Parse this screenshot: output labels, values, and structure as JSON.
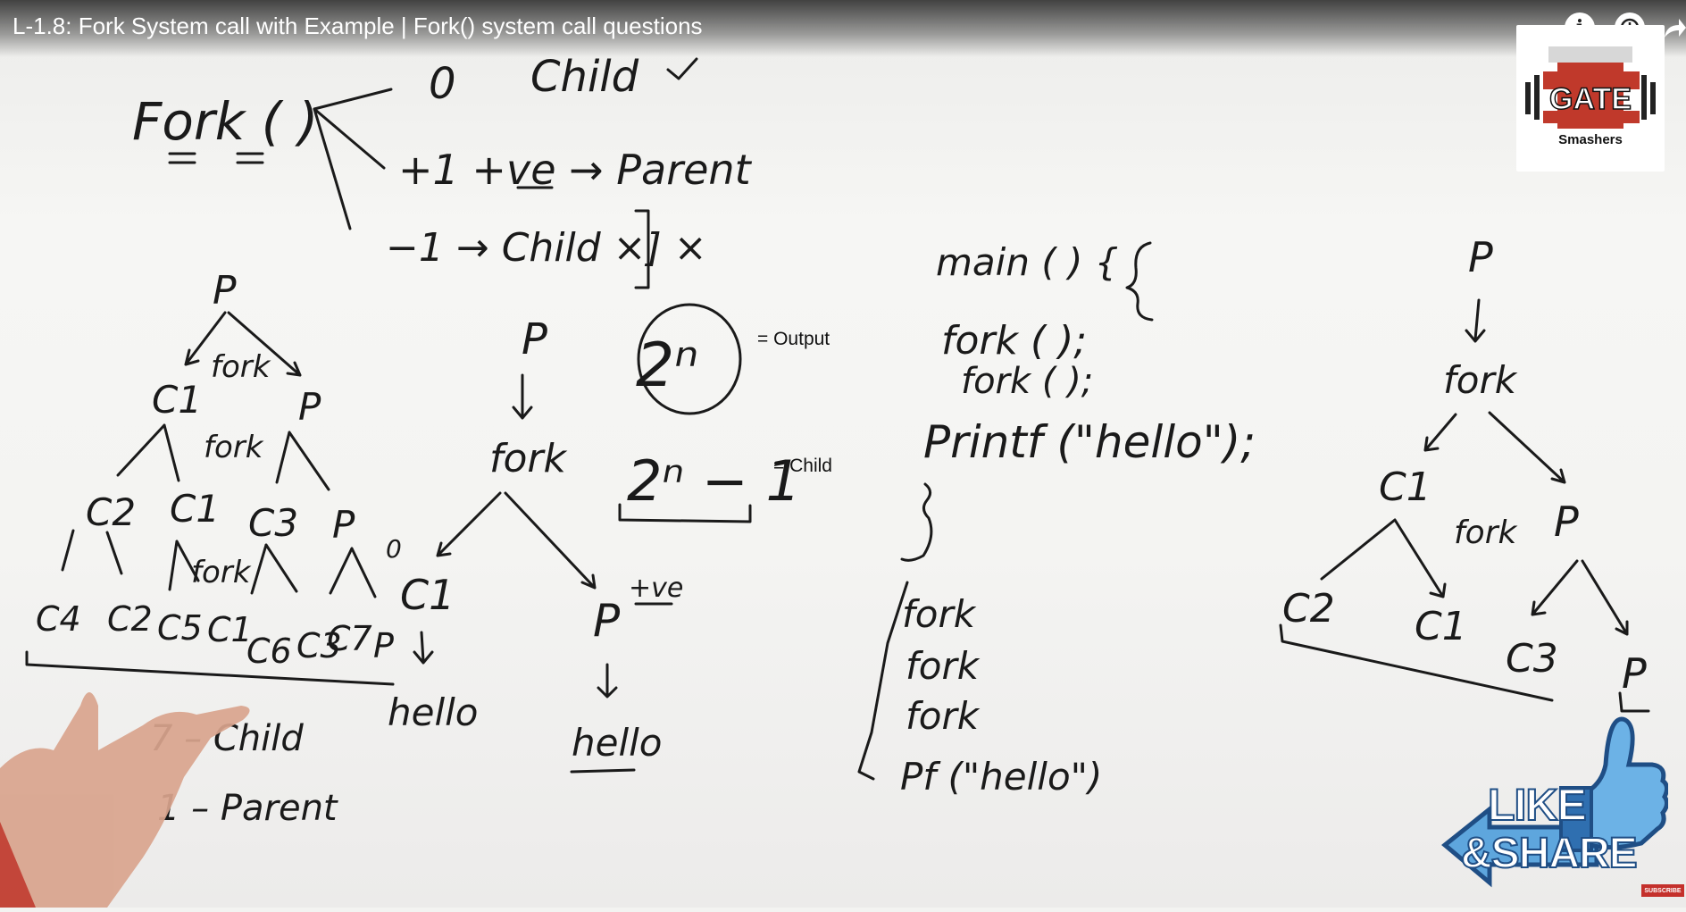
{
  "video": {
    "title": "L-1.8: Fork System call with Example | Fork() system call questions"
  },
  "controls": {
    "info_icon": "info-icon",
    "watch_later_icon": "clock-icon",
    "share_icon": "share-icon",
    "info_glyph": "i"
  },
  "logo": {
    "name": "GATE",
    "sub": "Smashers"
  },
  "annotations": {
    "output_label": "= Output",
    "child_label": "= Child"
  },
  "overlay": {
    "like": "LIKE",
    "share": "&SHARE",
    "subscribe": "SUBSCRIBE"
  },
  "whiteboard": {
    "fork_returns": {
      "title": "Fork ( )",
      "zero": "0",
      "zero_meaning": "Child",
      "positive": "+1  +ve → Parent",
      "negative": "−1 → Child ×] ×"
    },
    "formula_output": "2ⁿ",
    "formula_child": "2ⁿ − 1",
    "code": {
      "main": "main ( ) {",
      "line1": "fork ( );",
      "line2": "fork ( );",
      "line3": "Printf (\"hello\");",
      "close": "}"
    },
    "expanded": [
      "fork",
      "fork",
      "fork",
      "Pf (\"hello\")"
    ],
    "tree_left": {
      "root": "P",
      "fork1": "fork",
      "level1": [
        "C1",
        "P"
      ],
      "fork2": "fork",
      "level2": [
        "C2",
        "C1",
        "C3",
        "P"
      ],
      "fork3": "fork",
      "level3": [
        "C4",
        "C2",
        "C5",
        "C1",
        "C6",
        "C3",
        "C7",
        "P"
      ],
      "count_child": "7 – Child",
      "count_parent": "1 – Parent"
    },
    "tree_middle": {
      "root": "P",
      "fork": "fork",
      "child": "C1",
      "child_ret": "0",
      "parent": "P",
      "parent_ret": "+ve",
      "hello_child": "hello",
      "hello_parent": "hello"
    },
    "tree_right": {
      "root": "P",
      "fork1": "fork",
      "level1": [
        "C1",
        "P"
      ],
      "fork2": "fork",
      "level2": [
        "C2",
        "C1",
        "C3",
        "P"
      ]
    }
  }
}
